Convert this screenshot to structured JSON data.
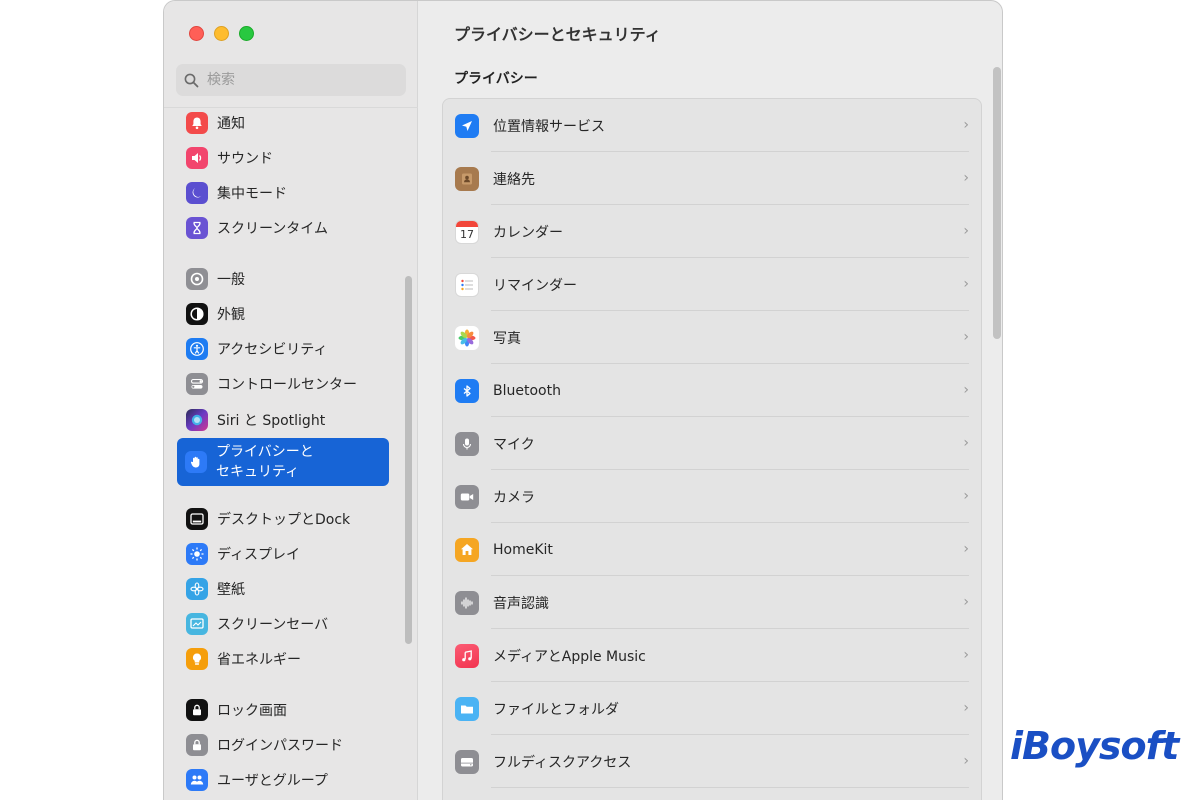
{
  "window": {
    "title": "プライバシーとセキュリティ",
    "section_title": "プライバシー"
  },
  "sidebar": {
    "search_placeholder": "検索",
    "items": [
      {
        "label": "通知",
        "icon": "bell-icon",
        "color": "#f34b4b"
      },
      {
        "label": "サウンド",
        "icon": "speaker-icon",
        "color": "#f2456d"
      },
      {
        "label": "集中モード",
        "icon": "moon-icon",
        "color": "#5b4fd0"
      },
      {
        "label": "スクリーンタイム",
        "icon": "hourglass-icon",
        "color": "#6a53d3"
      },
      {
        "label": "一般",
        "icon": "gear-icon",
        "color": "#8f8f94"
      },
      {
        "label": "外観",
        "icon": "appearance-icon",
        "color": "#111111"
      },
      {
        "label": "アクセシビリティ",
        "icon": "accessibility-icon",
        "color": "#1e7cf2"
      },
      {
        "label": "コントロールセンター",
        "icon": "toggles-icon",
        "color": "#8e8e93"
      },
      {
        "label": "Siri と Spotlight",
        "icon": "siri-icon",
        "color": "#6a3bc5"
      },
      {
        "label": "プライバシーと\nセキュリティ",
        "icon": "hand-icon",
        "color": "#2d7af7",
        "selected": true
      },
      {
        "label": "デスクトップとDock",
        "icon": "dock-icon",
        "color": "#111111"
      },
      {
        "label": "ディスプレイ",
        "icon": "sun-icon",
        "color": "#2d7af7"
      },
      {
        "label": "壁紙",
        "icon": "flower-icon",
        "color": "#35a3e6"
      },
      {
        "label": "スクリーンセーバ",
        "icon": "screensaver-icon",
        "color": "#47b6e0"
      },
      {
        "label": "省エネルギー",
        "icon": "bulb-icon",
        "color": "#f59e0b"
      },
      {
        "label": "ロック画面",
        "icon": "lock-screen-icon",
        "color": "#111111"
      },
      {
        "label": "ログインパスワード",
        "icon": "padlock-icon",
        "color": "#8e8e93"
      },
      {
        "label": "ユーザとグループ",
        "icon": "users-icon",
        "color": "#2d7af7"
      }
    ]
  },
  "privacy": {
    "items": [
      {
        "label": "位置情報サービス",
        "icon": "location-arrow-icon",
        "color": "#1f7cf3"
      },
      {
        "label": "連絡先",
        "icon": "contacts-icon",
        "color": "#a77a4e"
      },
      {
        "label": "カレンダー",
        "icon": "calendar-icon",
        "color": "#ffffff",
        "day": "17"
      },
      {
        "label": "リマインダー",
        "icon": "reminders-icon",
        "color": "#ffffff"
      },
      {
        "label": "写真",
        "icon": "photos-icon",
        "color": "#ffffff"
      },
      {
        "label": "Bluetooth",
        "icon": "bluetooth-icon",
        "color": "#1f7cf3"
      },
      {
        "label": "マイク",
        "icon": "microphone-icon",
        "color": "#8e8e93"
      },
      {
        "label": "カメラ",
        "icon": "camera-icon",
        "color": "#8e8e93"
      },
      {
        "label": "HomeKit",
        "icon": "home-icon",
        "color": "#f5a623"
      },
      {
        "label": "音声認識",
        "icon": "waveform-icon",
        "color": "#8e8e93"
      },
      {
        "label": "メディアとApple Music",
        "icon": "music-icon",
        "color": "#f2445b"
      },
      {
        "label": "ファイルとフォルダ",
        "icon": "folder-icon",
        "color": "#4ab3f4"
      },
      {
        "label": "フルディスクアクセス",
        "icon": "disk-icon",
        "color": "#8e8e93"
      }
    ]
  },
  "logo": {
    "text": "iBoysoft"
  }
}
